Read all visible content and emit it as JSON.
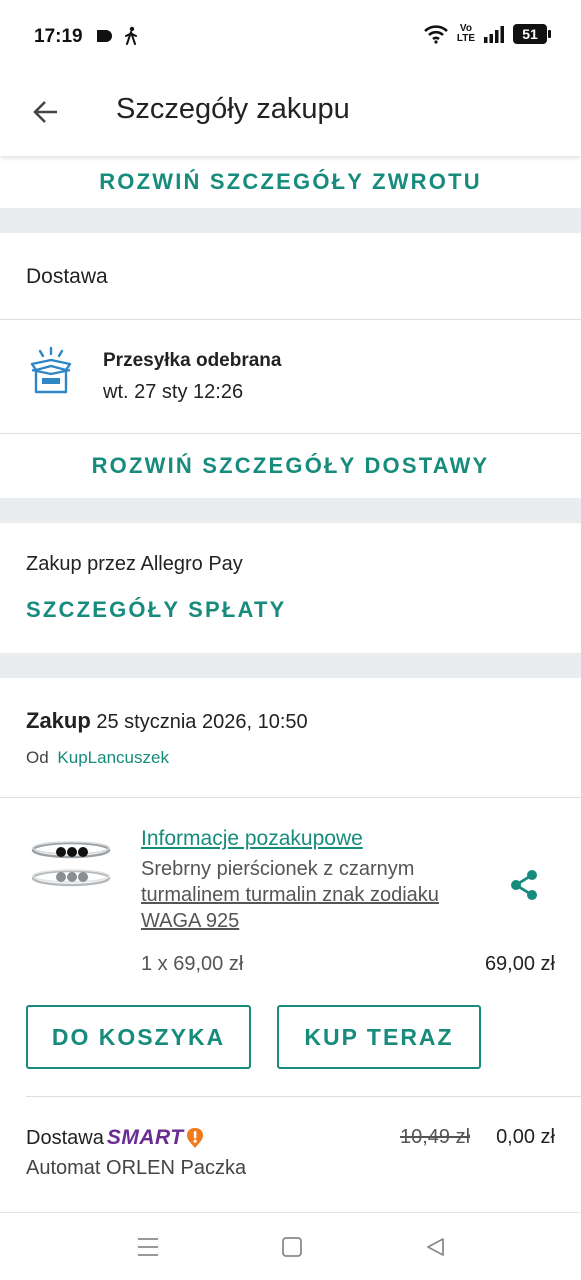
{
  "status_bar": {
    "time": "17:19",
    "left_icons": [
      "messenger-icon",
      "walking-icon"
    ],
    "right_icons": [
      "wifi-icon",
      "volte-icon",
      "signal-icon",
      "battery-icon"
    ],
    "volte_top": "Vo",
    "volte_bottom": "LTE",
    "battery": "51"
  },
  "app_bar": {
    "back_icon": "arrow-left-icon",
    "title": "Szczegóły zakupu"
  },
  "return_section": {
    "expand_label": "ROZWIŃ SZCZEGÓŁY ZWROTU"
  },
  "delivery_section": {
    "title": "Dostawa",
    "status_icon": "open-box-icon",
    "status": "Przesyłka odebrana",
    "date": "wt. 27 sty 12:26",
    "expand_label": "ROZWIŃ SZCZEGÓŁY DOSTAWY"
  },
  "payment_section": {
    "label": "Zakup przez Allegro Pay",
    "link": "SZCZEGÓŁY SPŁATY"
  },
  "purchase_section": {
    "title": "Zakup",
    "date": "25 stycznia 2026, 10:50",
    "seller_prefix": "Od",
    "seller_name": "KupLancuszek",
    "item": {
      "info_link": "Informacje pozakupowe",
      "name_line1": "Srebrny pierścionek z czarnym",
      "name_line2": "turmalinem turmalin znak zodiaku",
      "name_line3": "WAGA 925",
      "quantity_price": "1 x 69,00 zł",
      "total": "69,00 zł",
      "share_icon": "share-icon"
    },
    "buttons": {
      "add_to_cart": "DO KOSZYKA",
      "buy_now": "KUP TERAZ"
    },
    "shipping": {
      "label": "Dostawa",
      "badge": "SMART",
      "method": "Automat ORLEN Paczka",
      "old_price": "10,49 zł",
      "price": "0,00 zł"
    }
  },
  "nav_bar": {
    "icons": [
      "menu-icon",
      "home-square-icon",
      "back-triangle-icon"
    ]
  },
  "colors": {
    "accent": "#178b7c",
    "section_gap": "#e9edf0",
    "smart_purple": "#6b2c91",
    "smart_orange": "#f07b1d",
    "icon_blue": "#2f86c6"
  }
}
